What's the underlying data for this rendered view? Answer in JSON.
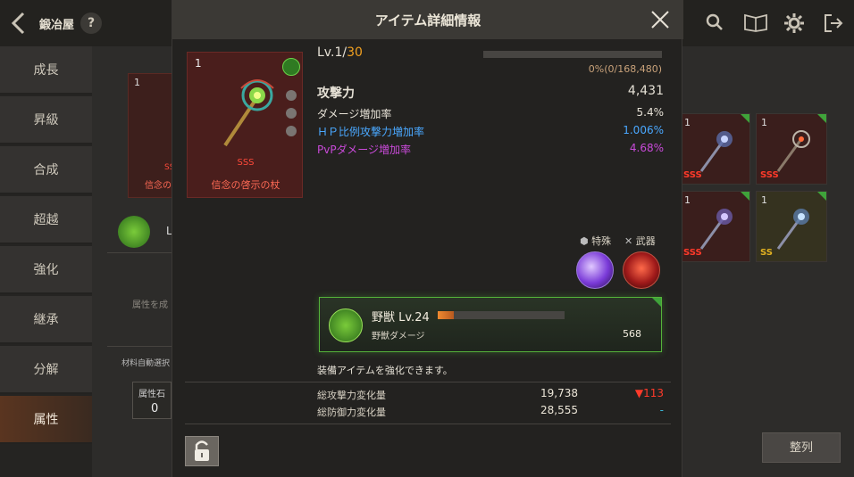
{
  "topbar": {
    "title": "鍛冶屋",
    "help_label": "?",
    "icons": [
      "search-icon",
      "book-icon",
      "gear-icon",
      "exit-icon"
    ]
  },
  "sidebar": {
    "items": [
      {
        "label": "成長",
        "active": false
      },
      {
        "label": "昇級",
        "active": false
      },
      {
        "label": "合成",
        "active": false
      },
      {
        "label": "超越",
        "active": false
      },
      {
        "label": "強化",
        "active": false
      },
      {
        "label": "継承",
        "active": false
      },
      {
        "label": "分解",
        "active": false
      },
      {
        "label": "属性",
        "active": true
      }
    ]
  },
  "background": {
    "card_count": "1",
    "card_grade": "SSS",
    "card_name": "信念の",
    "row_label": "L",
    "attr_text": "属性を成",
    "auto_label": "材料自動選択",
    "stone_label": "属性石",
    "stone_value": "0",
    "right_cards": [
      {
        "count": "1",
        "grade": "SSS",
        "color": "#ff3a2a"
      },
      {
        "count": "1",
        "grade": "SSS",
        "color": "#ff3a2a"
      },
      {
        "count": "1",
        "grade": "SSS",
        "color": "#ff3a2a"
      },
      {
        "count": "1",
        "grade": "SS",
        "color": "#e0b020"
      }
    ],
    "sort_label": "整列"
  },
  "modal": {
    "title": "アイテム詳細情報",
    "item": {
      "count": "1",
      "grade": "SSS",
      "name": "信念の啓示の杖"
    },
    "level": {
      "prefix": "Lv.1/",
      "max": "30"
    },
    "xp": {
      "text": "0%(0/168,480)",
      "fraction": 0.0
    },
    "stats": [
      {
        "label": "攻撃力",
        "value": "4,431",
        "color": "#f2ecde"
      },
      {
        "label": "ダメージ増加率",
        "value": "5.4%",
        "color": "#e6e1d6"
      },
      {
        "label": "ＨＰ比例攻撃力増加率",
        "value": "1.006%",
        "color": "#4aa8ff"
      },
      {
        "label": "PvPダメージ増加率",
        "value": "4.68%",
        "color": "#c84ad8"
      }
    ],
    "tags": {
      "special": "特殊",
      "weapon": "武器"
    },
    "pet": {
      "name": "野獣 Lv.24",
      "progress": 0.13,
      "sub_label": "野獣ダメージ",
      "sub_value": "568"
    },
    "enhance_text": "装備アイテムを強化できます。",
    "summary": [
      {
        "label": "総攻撃力変化量",
        "value": "19,738",
        "diff": "▼113",
        "diff_color": "#ff3a2a"
      },
      {
        "label": "総防御力変化量",
        "value": "28,555",
        "diff": "-",
        "diff_color": "#3ab8d8"
      }
    ]
  }
}
